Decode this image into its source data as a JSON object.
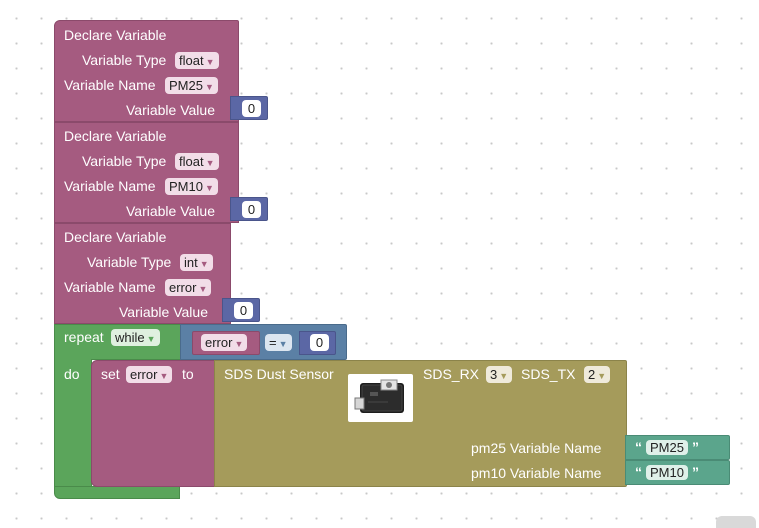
{
  "declare_blocks": [
    {
      "title": "Declare Variable",
      "type_label": "Variable Type",
      "type_value": "float",
      "name_label": "Variable Name",
      "name_value": "PM25",
      "value_label": "Variable Value",
      "value": "0"
    },
    {
      "title": "Declare Variable",
      "type_label": "Variable Type",
      "type_value": "float",
      "name_label": "Variable Name",
      "name_value": "PM10",
      "value_label": "Variable Value",
      "value": "0"
    },
    {
      "title": "Declare Variable",
      "type_label": "Variable Type",
      "type_value": "int",
      "name_label": "Variable Name",
      "name_value": "error",
      "value_label": "Variable Value",
      "value": "0"
    }
  ],
  "repeat_block": {
    "label": "repeat",
    "mode": "while",
    "do_label": "do",
    "condition": {
      "var": "error",
      "op": "=",
      "value": "0"
    }
  },
  "set_block": {
    "label": "set",
    "var": "error",
    "to_label": "to"
  },
  "sensor_block": {
    "title": "SDS Dust Sensor",
    "rx_label": "SDS_RX",
    "rx_value": "3",
    "tx_label": "SDS_TX",
    "tx_value": "2",
    "pm25_label": "pm25 Variable Name",
    "pm25_value": "PM25",
    "pm10_label": "pm10 Variable Name",
    "pm10_value": "PM10"
  },
  "dropdown_arrow": "▼",
  "quote_open": "“",
  "quote_close": "”",
  "colors": {
    "variable": "#a55b80",
    "loop": "#5ba55b",
    "logic": "#5b80a5",
    "sensor": "#a59b5b",
    "string": "#5ba58c",
    "number_socket": "#5b67a5"
  },
  "icons": {
    "sensor_image": "dust-sensor-module"
  }
}
